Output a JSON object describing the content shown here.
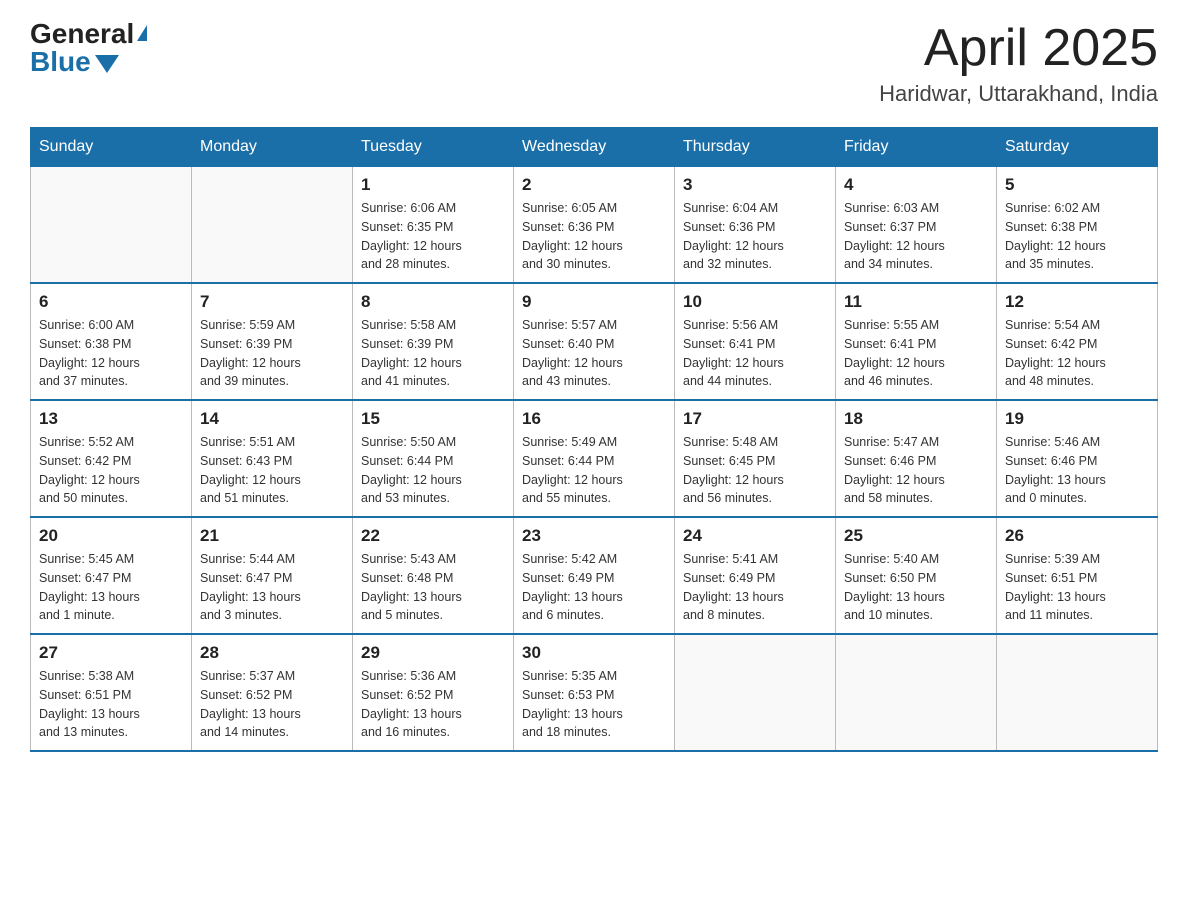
{
  "header": {
    "logo_general": "General",
    "logo_blue": "Blue",
    "title": "April 2025",
    "subtitle": "Haridwar, Uttarakhand, India"
  },
  "days_of_week": [
    "Sunday",
    "Monday",
    "Tuesday",
    "Wednesday",
    "Thursday",
    "Friday",
    "Saturday"
  ],
  "weeks": [
    [
      {
        "day": "",
        "info": ""
      },
      {
        "day": "",
        "info": ""
      },
      {
        "day": "1",
        "info": "Sunrise: 6:06 AM\nSunset: 6:35 PM\nDaylight: 12 hours\nand 28 minutes."
      },
      {
        "day": "2",
        "info": "Sunrise: 6:05 AM\nSunset: 6:36 PM\nDaylight: 12 hours\nand 30 minutes."
      },
      {
        "day": "3",
        "info": "Sunrise: 6:04 AM\nSunset: 6:36 PM\nDaylight: 12 hours\nand 32 minutes."
      },
      {
        "day": "4",
        "info": "Sunrise: 6:03 AM\nSunset: 6:37 PM\nDaylight: 12 hours\nand 34 minutes."
      },
      {
        "day": "5",
        "info": "Sunrise: 6:02 AM\nSunset: 6:38 PM\nDaylight: 12 hours\nand 35 minutes."
      }
    ],
    [
      {
        "day": "6",
        "info": "Sunrise: 6:00 AM\nSunset: 6:38 PM\nDaylight: 12 hours\nand 37 minutes."
      },
      {
        "day": "7",
        "info": "Sunrise: 5:59 AM\nSunset: 6:39 PM\nDaylight: 12 hours\nand 39 minutes."
      },
      {
        "day": "8",
        "info": "Sunrise: 5:58 AM\nSunset: 6:39 PM\nDaylight: 12 hours\nand 41 minutes."
      },
      {
        "day": "9",
        "info": "Sunrise: 5:57 AM\nSunset: 6:40 PM\nDaylight: 12 hours\nand 43 minutes."
      },
      {
        "day": "10",
        "info": "Sunrise: 5:56 AM\nSunset: 6:41 PM\nDaylight: 12 hours\nand 44 minutes."
      },
      {
        "day": "11",
        "info": "Sunrise: 5:55 AM\nSunset: 6:41 PM\nDaylight: 12 hours\nand 46 minutes."
      },
      {
        "day": "12",
        "info": "Sunrise: 5:54 AM\nSunset: 6:42 PM\nDaylight: 12 hours\nand 48 minutes."
      }
    ],
    [
      {
        "day": "13",
        "info": "Sunrise: 5:52 AM\nSunset: 6:42 PM\nDaylight: 12 hours\nand 50 minutes."
      },
      {
        "day": "14",
        "info": "Sunrise: 5:51 AM\nSunset: 6:43 PM\nDaylight: 12 hours\nand 51 minutes."
      },
      {
        "day": "15",
        "info": "Sunrise: 5:50 AM\nSunset: 6:44 PM\nDaylight: 12 hours\nand 53 minutes."
      },
      {
        "day": "16",
        "info": "Sunrise: 5:49 AM\nSunset: 6:44 PM\nDaylight: 12 hours\nand 55 minutes."
      },
      {
        "day": "17",
        "info": "Sunrise: 5:48 AM\nSunset: 6:45 PM\nDaylight: 12 hours\nand 56 minutes."
      },
      {
        "day": "18",
        "info": "Sunrise: 5:47 AM\nSunset: 6:46 PM\nDaylight: 12 hours\nand 58 minutes."
      },
      {
        "day": "19",
        "info": "Sunrise: 5:46 AM\nSunset: 6:46 PM\nDaylight: 13 hours\nand 0 minutes."
      }
    ],
    [
      {
        "day": "20",
        "info": "Sunrise: 5:45 AM\nSunset: 6:47 PM\nDaylight: 13 hours\nand 1 minute."
      },
      {
        "day": "21",
        "info": "Sunrise: 5:44 AM\nSunset: 6:47 PM\nDaylight: 13 hours\nand 3 minutes."
      },
      {
        "day": "22",
        "info": "Sunrise: 5:43 AM\nSunset: 6:48 PM\nDaylight: 13 hours\nand 5 minutes."
      },
      {
        "day": "23",
        "info": "Sunrise: 5:42 AM\nSunset: 6:49 PM\nDaylight: 13 hours\nand 6 minutes."
      },
      {
        "day": "24",
        "info": "Sunrise: 5:41 AM\nSunset: 6:49 PM\nDaylight: 13 hours\nand 8 minutes."
      },
      {
        "day": "25",
        "info": "Sunrise: 5:40 AM\nSunset: 6:50 PM\nDaylight: 13 hours\nand 10 minutes."
      },
      {
        "day": "26",
        "info": "Sunrise: 5:39 AM\nSunset: 6:51 PM\nDaylight: 13 hours\nand 11 minutes."
      }
    ],
    [
      {
        "day": "27",
        "info": "Sunrise: 5:38 AM\nSunset: 6:51 PM\nDaylight: 13 hours\nand 13 minutes."
      },
      {
        "day": "28",
        "info": "Sunrise: 5:37 AM\nSunset: 6:52 PM\nDaylight: 13 hours\nand 14 minutes."
      },
      {
        "day": "29",
        "info": "Sunrise: 5:36 AM\nSunset: 6:52 PM\nDaylight: 13 hours\nand 16 minutes."
      },
      {
        "day": "30",
        "info": "Sunrise: 5:35 AM\nSunset: 6:53 PM\nDaylight: 13 hours\nand 18 minutes."
      },
      {
        "day": "",
        "info": ""
      },
      {
        "day": "",
        "info": ""
      },
      {
        "day": "",
        "info": ""
      }
    ]
  ]
}
